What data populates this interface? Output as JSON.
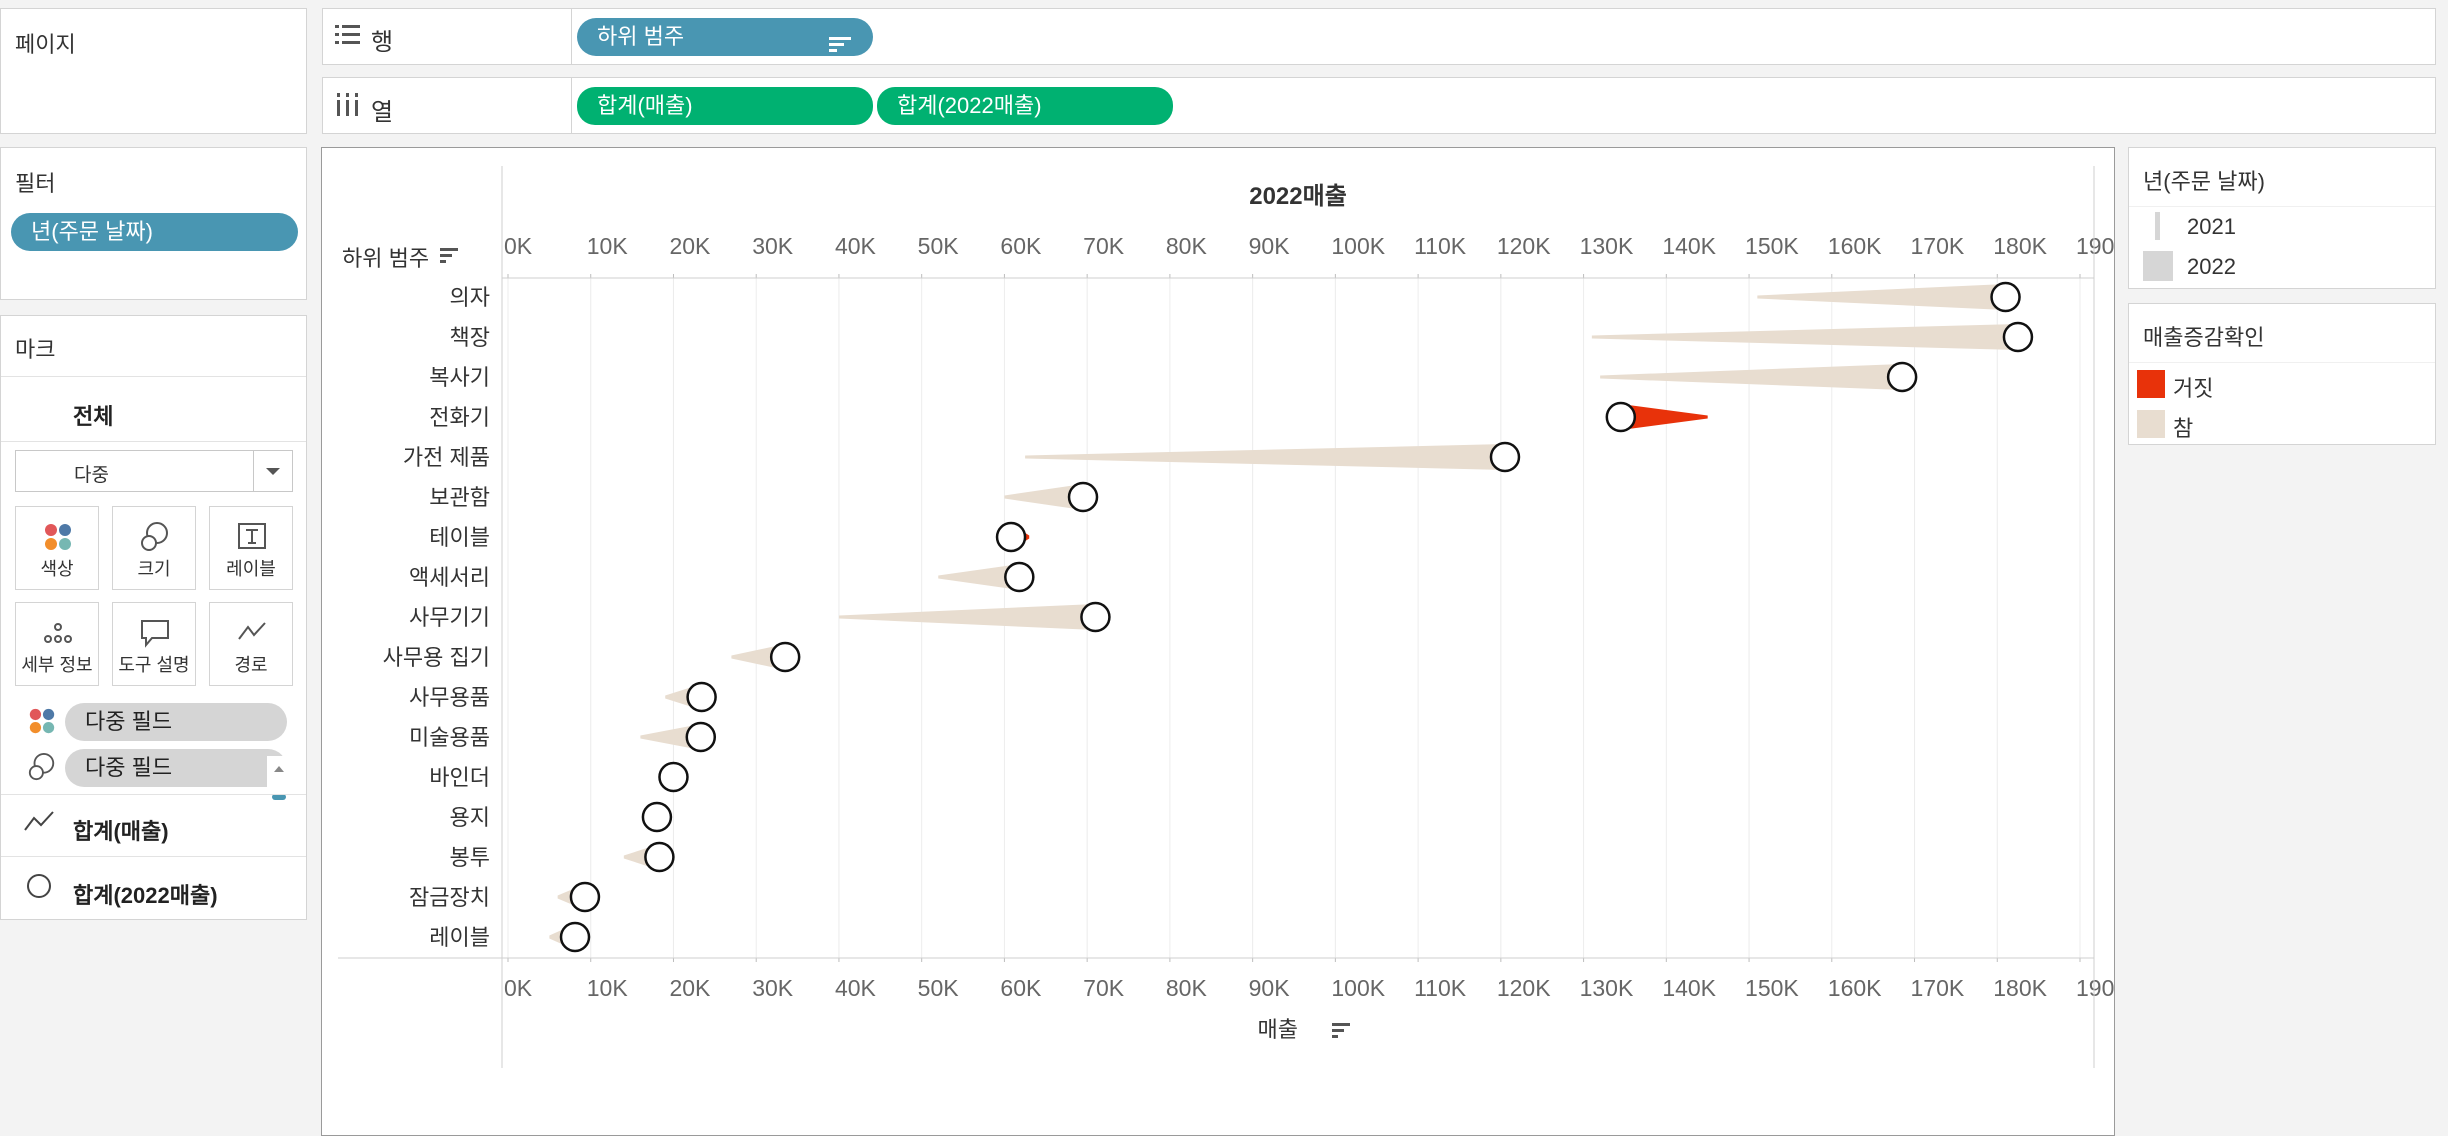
{
  "pages_panel": {
    "title": "페이지"
  },
  "rows_shelf": {
    "label": "행",
    "pill": "하위 범주"
  },
  "cols_shelf": {
    "label": "열",
    "pills": [
      "합계(매출)",
      "합계(2022매출)"
    ]
  },
  "filters_panel": {
    "title": "필터",
    "pill": "년(주문 날짜)"
  },
  "marks_panel": {
    "title": "마크",
    "all_label": "전체",
    "mark_type": "다중",
    "cards": [
      {
        "label": "색상",
        "icon": "color-icon"
      },
      {
        "label": "크기",
        "icon": "size-icon"
      },
      {
        "label": "레이블",
        "icon": "label-icon"
      },
      {
        "label": "세부 정보",
        "icon": "detail-icon"
      },
      {
        "label": "도구 설명",
        "icon": "tooltip-icon"
      },
      {
        "label": "경로",
        "icon": "path-icon"
      }
    ],
    "fields": [
      "다중 필드",
      "다중 필드"
    ],
    "measure_tabs": [
      "합계(매출)",
      "합계(2022매출)"
    ]
  },
  "legend_year": {
    "title": "년(주문 날짜)",
    "items": [
      "2021",
      "2022"
    ]
  },
  "legend_change": {
    "title": "매출증감확인",
    "items": [
      {
        "label": "거짓",
        "color": "#e8320a"
      },
      {
        "label": "참",
        "color": "#e8ddd0"
      }
    ]
  },
  "chart_data": {
    "type": "scatter",
    "top_axis_title": "2022매출",
    "bottom_axis_title": "매출",
    "row_header": "하위 범주",
    "xlim": [
      0,
      190000
    ],
    "ticks": [
      "0K",
      "10K",
      "20K",
      "30K",
      "40K",
      "50K",
      "60K",
      "70K",
      "80K",
      "90K",
      "100K",
      "110K",
      "120K",
      "130K",
      "140K",
      "150K",
      "160K",
      "170K",
      "180K",
      "190K"
    ],
    "categories": [
      "의자",
      "책장",
      "복사기",
      "전화기",
      "가전 제품",
      "보관함",
      "테이블",
      "액세서리",
      "사무기기",
      "사무용 집기",
      "사무용품",
      "미술용품",
      "바인더",
      "용지",
      "봉투",
      "잠금장치",
      "레이블"
    ],
    "sales_2021": [
      151000,
      131000,
      132000,
      145000,
      62500,
      60000,
      63000,
      52000,
      40000,
      27000,
      19000,
      16000,
      19000,
      17000,
      14000,
      6000,
      5000
    ],
    "sales_2022": [
      181000,
      182500,
      168500,
      134500,
      120500,
      69500,
      60800,
      61800,
      71000,
      33500,
      23400,
      23300,
      20000,
      18000,
      18300,
      9300,
      8100
    ],
    "increase": [
      true,
      true,
      true,
      false,
      true,
      true,
      false,
      true,
      true,
      true,
      true,
      true,
      true,
      true,
      true,
      true,
      true
    ],
    "colors": {
      "true": "#e8ddd0",
      "false": "#e8320a"
    }
  }
}
